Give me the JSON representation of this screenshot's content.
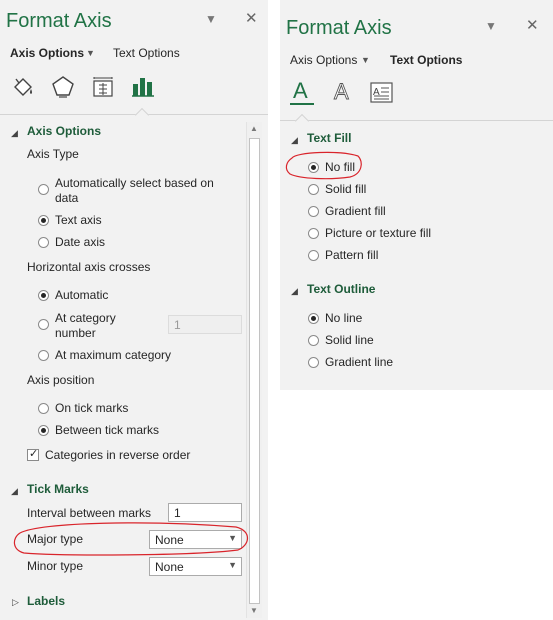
{
  "left": {
    "title": "Format Axis",
    "tabs": {
      "axis_options": "Axis Options",
      "text_options": "Text Options"
    },
    "icons": [
      "paint-bucket-icon",
      "pentagon-effects-icon",
      "size-properties-icon",
      "bar-chart-icon"
    ],
    "axis_options_section": "Axis Options",
    "axis_type": {
      "label": "Axis Type",
      "options": [
        "Automatically select based on",
        "data",
        "Text axis",
        "Date axis"
      ]
    },
    "hcross": {
      "label": "Horizontal axis crosses",
      "automatic": "Automatic",
      "at_category_1": "At category",
      "at_category_2": "number",
      "at_category_value": "1",
      "at_max": "At maximum category"
    },
    "axis_position": {
      "label": "Axis position",
      "on_tick": "On tick marks",
      "between": "Between tick marks"
    },
    "reverse_order": "Categories in reverse order",
    "tick_marks": {
      "section": "Tick Marks",
      "interval_label": "Interval between marks",
      "interval_value": "1",
      "major_label": "Major type",
      "major_value": "None",
      "minor_label": "Minor type",
      "minor_value": "None"
    },
    "labels_section": "Labels"
  },
  "right": {
    "title": "Format Axis",
    "tabs": {
      "axis_options": "Axis Options",
      "text_options": "Text Options"
    },
    "icons": [
      "text-fill-icon",
      "text-outline-icon",
      "text-box-icon"
    ],
    "text_fill": {
      "section": "Text Fill",
      "options": [
        "No fill",
        "Solid fill",
        "Gradient fill",
        "Picture or texture fill",
        "Pattern fill"
      ]
    },
    "text_outline": {
      "section": "Text Outline",
      "options": [
        "No line",
        "Solid line",
        "Gradient line"
      ]
    }
  },
  "colors": {
    "accent": "#217346",
    "annotation": "#d9242b"
  }
}
